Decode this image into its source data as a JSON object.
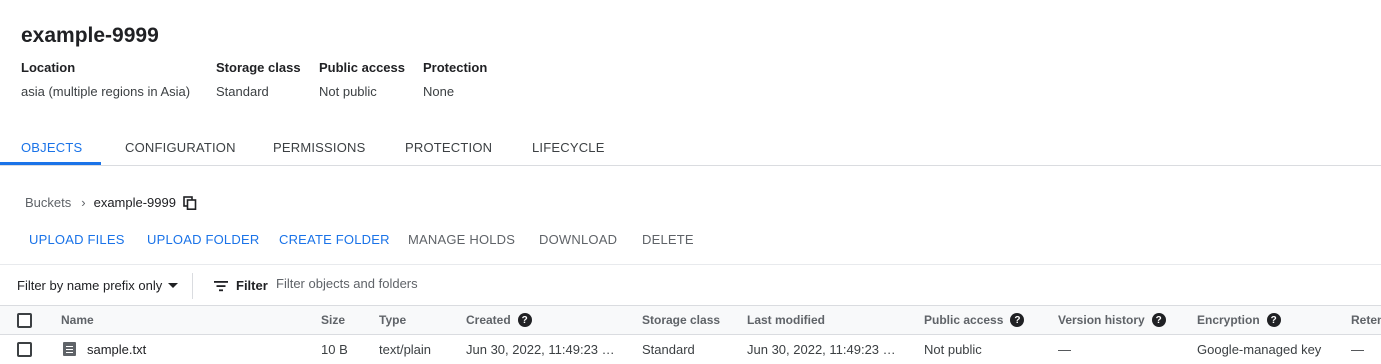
{
  "bucket": {
    "name": "example-9999",
    "meta": [
      {
        "label": "Location",
        "value": "asia (multiple regions in Asia)"
      },
      {
        "label": "Storage class",
        "value": "Standard"
      },
      {
        "label": "Public access",
        "value": "Not public"
      },
      {
        "label": "Protection",
        "value": "None"
      }
    ]
  },
  "tabs": [
    "OBJECTS",
    "CONFIGURATION",
    "PERMISSIONS",
    "PROTECTION",
    "LIFECYCLE"
  ],
  "active_tab": "OBJECTS",
  "breadcrumb": {
    "root": "Buckets",
    "separator": "›",
    "current": "example-9999",
    "copy_icon": "copy-icon"
  },
  "actions": [
    {
      "label": "UPLOAD FILES",
      "enabled": true
    },
    {
      "label": "UPLOAD FOLDER",
      "enabled": true
    },
    {
      "label": "CREATE FOLDER",
      "enabled": true
    },
    {
      "label": "MANAGE HOLDS",
      "enabled": false
    },
    {
      "label": "DOWNLOAD",
      "enabled": false
    },
    {
      "label": "DELETE",
      "enabled": false
    }
  ],
  "filter": {
    "mode_label": "Filter by name prefix only",
    "button_label": "Filter",
    "placeholder": "Filter objects and folders"
  },
  "table": {
    "columns": [
      "Name",
      "Size",
      "Type",
      "Created",
      "Storage class",
      "Last modified",
      "Public access",
      "Version history",
      "Encryption",
      "Reten"
    ],
    "help_glyph": "?",
    "rows": [
      {
        "name": "sample.txt",
        "size": "10 B",
        "type": "text/plain",
        "created": "Jun 30, 2022, 11:49:23 …",
        "storage_class": "Standard",
        "last_modified": "Jun 30, 2022, 11:49:23 …",
        "public_access": "Not public",
        "version_history": "—",
        "encryption": "Google-managed key",
        "retention": "—"
      }
    ]
  },
  "colors": {
    "accent": "#1a73e8",
    "text": "#202124",
    "muted": "#5f6368",
    "divider": "#dadce0"
  }
}
